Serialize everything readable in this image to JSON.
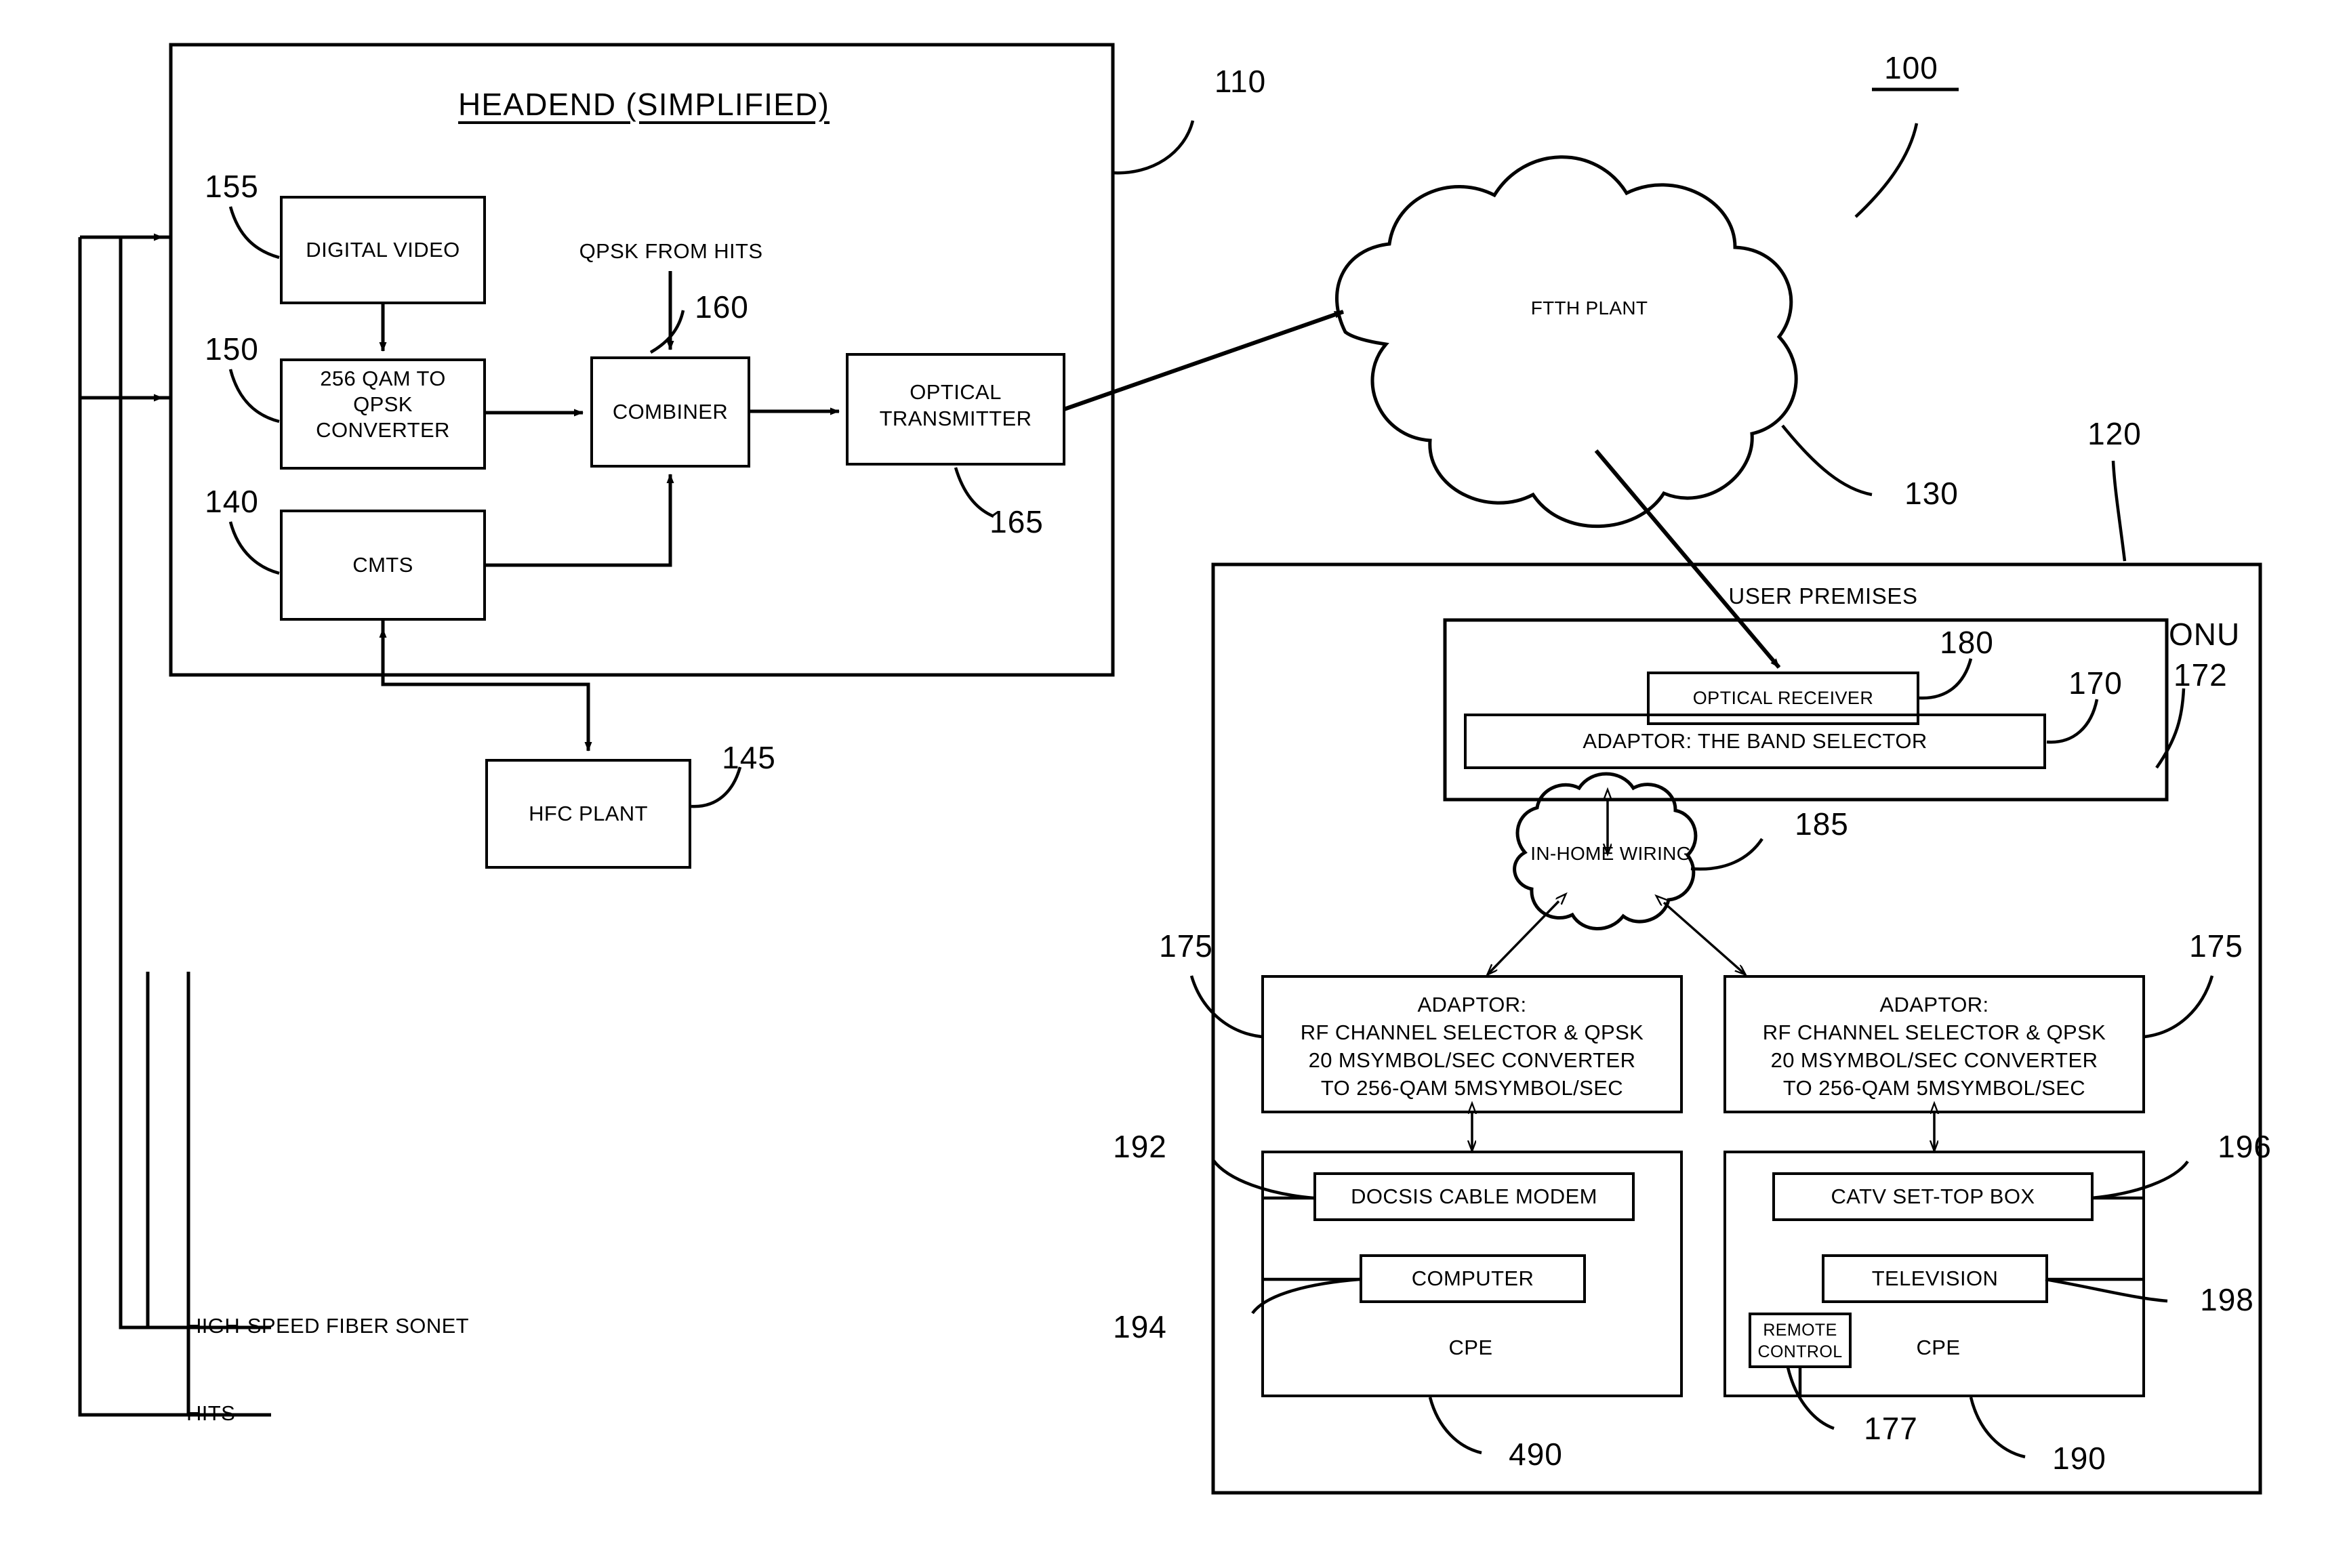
{
  "figure": {
    "title_ref": "100",
    "headend_title": "HEADEND (SIMPLIFIED)",
    "headend_ref": "110",
    "user_premises_label": "USER PREMISES",
    "user_premises_ref": "120",
    "onu_label": "ONU",
    "onu_ref": "172"
  },
  "headend": {
    "digital_video": "DIGITAL VIDEO",
    "digital_video_ref": "155",
    "qam_converter_line1": "256 QAM TO",
    "qam_converter_line2": "QPSK",
    "qam_converter_line3": "CONVERTER",
    "qam_converter_ref": "150",
    "cmts": "CMTS",
    "cmts_ref": "140",
    "combiner": "COMBINER",
    "combiner_ref": "160",
    "optical_transmitter_line1": "OPTICAL",
    "optical_transmitter_line2": "TRANSMITTER",
    "optical_transmitter_ref": "165",
    "qpsk_from_hits": "QPSK FROM HITS",
    "hfc_plant": "HFC PLANT",
    "hfc_plant_ref": "145",
    "high_speed_fiber_sonet": "HIGH-SPEED FIBER SONET",
    "hits": "HITS"
  },
  "network": {
    "ftth_plant": "FTTH PLANT",
    "ftth_plant_ref": "130",
    "in_home_wiring": "IN-HOME WIRING",
    "in_home_wiring_ref": "185"
  },
  "onu": {
    "optical_receiver": "OPTICAL RECEIVER",
    "optical_receiver_ref": "180",
    "band_selector": "ADAPTOR: THE BAND SELECTOR",
    "band_selector_ref": "170"
  },
  "adaptors": [
    {
      "line1": "ADAPTOR:",
      "line2": "RF CHANNEL SELECTOR & QPSK",
      "line3": "20 MSYMBOL/SEC CONVERTER",
      "line4": "TO 256-QAM 5MSYMBOL/SEC",
      "ref": "175"
    },
    {
      "line1": "ADAPTOR:",
      "line2": "RF CHANNEL SELECTOR & QPSK",
      "line3": "20 MSYMBOL/SEC CONVERTER",
      "line4": "TO 256-QAM 5MSYMBOL/SEC",
      "ref": "175"
    }
  ],
  "cpe_left": {
    "modem": "DOCSIS CABLE MODEM",
    "modem_ref": "192",
    "computer": "COMPUTER",
    "computer_ref": "194",
    "cpe_label": "CPE",
    "cpe_ref": "490"
  },
  "cpe_right": {
    "set_top_box": "CATV SET-TOP BOX",
    "set_top_box_ref": "196",
    "television": "TELEVISION",
    "television_ref": "198",
    "remote_line1": "REMOTE",
    "remote_line2": "CONTROL",
    "remote_ref": "177",
    "cpe_label": "CPE",
    "cpe_ref": "190"
  },
  "colors": {
    "ink": "#000000",
    "paper": "#ffffff"
  }
}
